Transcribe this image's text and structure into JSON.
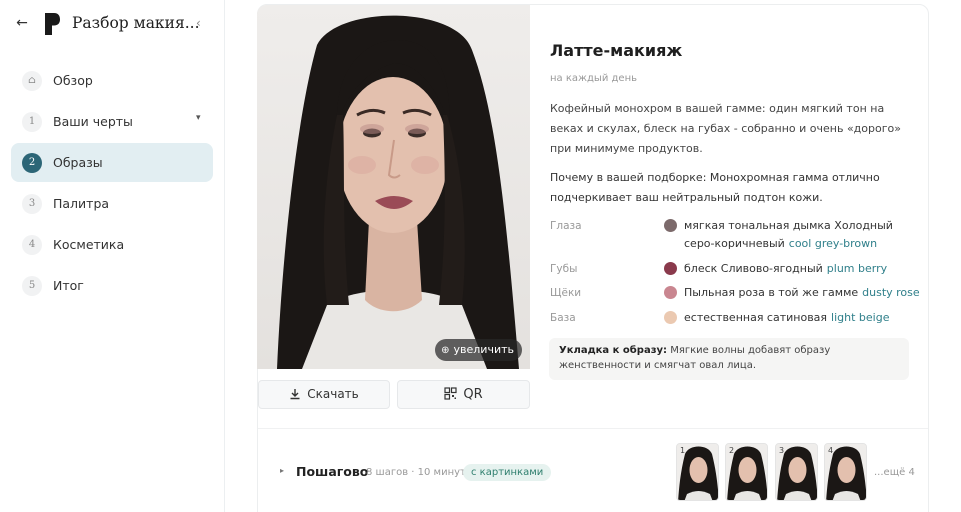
{
  "header": {
    "app_title": "Разбор макия...",
    "back_icon": "arrow-left-icon",
    "collapse_icon": "chevron-left-icon"
  },
  "sidebar": {
    "items": [
      {
        "num": "⌂",
        "label": "Обзор",
        "active": false
      },
      {
        "num": "1",
        "label": "Ваши черты",
        "active": false,
        "expandable": true
      },
      {
        "num": "2",
        "label": "Образы",
        "active": true
      },
      {
        "num": "3",
        "label": "Палитра",
        "active": false
      },
      {
        "num": "4",
        "label": "Косметика",
        "active": false
      },
      {
        "num": "5",
        "label": "Итог",
        "active": false
      }
    ]
  },
  "photo": {
    "zoom_label": "увеличить"
  },
  "actions": {
    "download_label": "Скачать",
    "qr_label": "QR"
  },
  "look": {
    "title": "Латте-макияж",
    "subtitle": "на каждый день",
    "description": "Кофейный монохром в вашей гамме: один мягкий тон на веках и скулах, блеск на губах - собранно и очень «дорого» при минимуме продуктов.",
    "why": "Почему в вашей подборке: Монохромная гамма отлично подчеркивает ваш нейтральный подтон кожи.",
    "rows": [
      {
        "label": "Глаза",
        "color": "#7c6a6b",
        "text": "мягкая тональная дымка Холодный серо-коричневый",
        "en": "cool grey-brown"
      },
      {
        "label": "Губы",
        "color": "#8a3a4c",
        "text": "блеск Сливово-ягодный",
        "en": "plum berry"
      },
      {
        "label": "Щёки",
        "color": "#c98690",
        "text": "Пыльная роза в той же гамме",
        "en": "dusty rose"
      },
      {
        "label": "База",
        "color": "#ebc9b1",
        "text": "естественная сатиновая",
        "en": "light beige"
      }
    ],
    "tip_title": "Укладка к образу:",
    "tip_text": "Мягкие волны добавят образу женственности и смягчат овал лица."
  },
  "steps": {
    "title": "Пошагово",
    "meta": "8 шагов · 10 минут",
    "badge": "с картинками",
    "thumbs": [
      "1",
      "2",
      "3",
      "4"
    ],
    "more": "...ещё 4"
  },
  "colors": {
    "accent": "#2c6677",
    "active_bg": "#e2eef2",
    "link": "#2f7f8a"
  }
}
